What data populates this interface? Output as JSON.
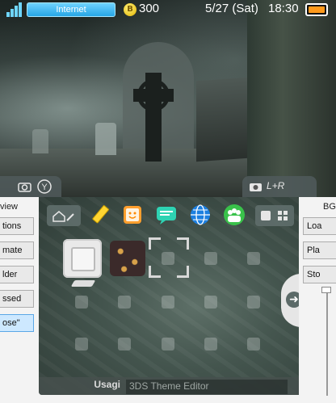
{
  "status_bar": {
    "connection_label": "Internet",
    "play_coins": "300",
    "date": "5/27 (Sat)",
    "time": "18:30",
    "battery_color": "#ff9a1c"
  },
  "top_screen": {
    "left_hint_icons": [
      "camera-icon",
      "y-button-icon"
    ],
    "left_hint_text": "Ⓨ",
    "right_hint_text": "L+R"
  },
  "left_panel": {
    "header": "view",
    "buttons": [
      {
        "label": "tions",
        "selected": false
      },
      {
        "label": "mate",
        "selected": false
      },
      {
        "label": "lder",
        "selected": false
      },
      {
        "label": "ssed",
        "selected": false
      },
      {
        "label": "ose\"",
        "selected": true
      }
    ]
  },
  "right_panel": {
    "header": "BG",
    "buttons": [
      "Loa",
      "Pla",
      "Sto"
    ]
  },
  "bottom_screen": {
    "toolbar_icons": [
      "pencil-icon",
      "smiley-icon",
      "chat-icon",
      "globe-icon",
      "friends-icon"
    ],
    "footer_author": "Usagi",
    "footer_title": "3DS Theme Editor",
    "accent": "#6fd3ff"
  }
}
